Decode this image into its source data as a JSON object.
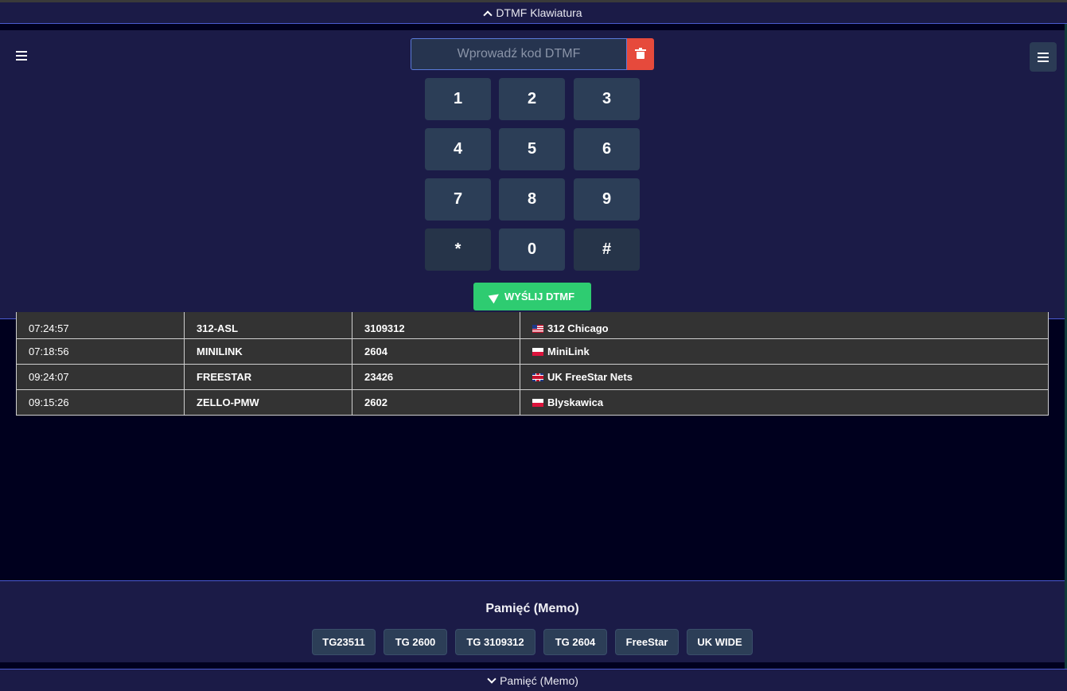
{
  "dtmf_header": {
    "label": "DTMF Klawiatura"
  },
  "dtmf_input": {
    "placeholder": "Wprowadź kod DTMF",
    "value": ""
  },
  "keypad": {
    "keys": [
      "1",
      "2",
      "3",
      "4",
      "5",
      "6",
      "7",
      "8",
      "9",
      "*",
      "0",
      "#"
    ]
  },
  "send_button": {
    "label": "WYŚLIJ DTMF"
  },
  "log": {
    "rows": [
      {
        "time": "07:24:57",
        "name": "312-ASL",
        "tg": "3109312",
        "flag": "us",
        "desc": "312 Chicago"
      },
      {
        "time": "07:18:56",
        "name": "MINILINK",
        "tg": "2604",
        "flag": "pl",
        "desc": "MiniLink"
      },
      {
        "time": "09:24:07",
        "name": "FREESTAR",
        "tg": "23426",
        "flag": "uk",
        "desc": "UK FreeStar Nets"
      },
      {
        "time": "09:15:26",
        "name": "ZELLO-PMW",
        "tg": "2602",
        "flag": "pl",
        "desc": "Blyskawica"
      }
    ]
  },
  "memo": {
    "title": "Pamięć (Memo)",
    "buttons": [
      "TG23511",
      "TG 2600",
      "TG 3109312",
      "TG 2604",
      "FreeStar",
      "UK WIDE"
    ]
  },
  "memo_footer": {
    "label": "Pamięć (Memo)"
  },
  "colors": {
    "panel": "#1b1b47",
    "background": "#00001e",
    "key": "#2c3e57",
    "send": "#2ecc71",
    "clear": "#e64a3c",
    "accent_border": "#4a5ad0"
  }
}
